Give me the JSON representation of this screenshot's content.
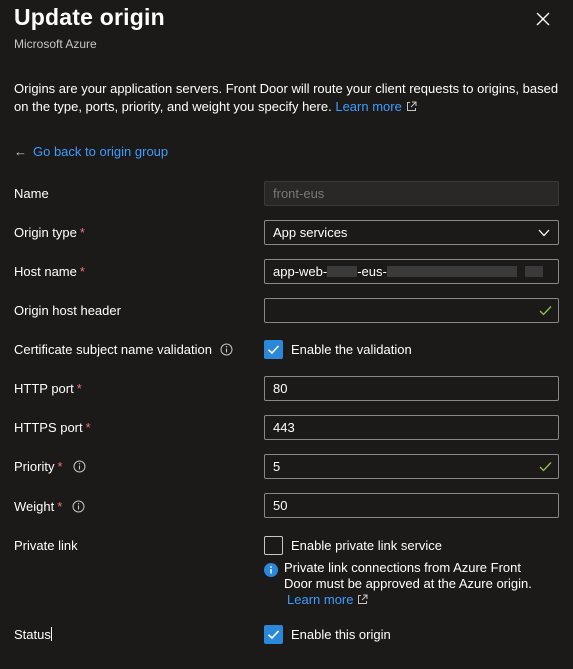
{
  "header": {
    "title": "Update origin",
    "subtitle": "Microsoft Azure"
  },
  "intro": {
    "text": "Origins are your application servers. Front Door will route your client requests to origins, based on the type, ports, priority, and weight you specify here.",
    "learn_more": "Learn more"
  },
  "back_link": "Go back to origin group",
  "form": {
    "name": {
      "label": "Name",
      "value": "front-eus"
    },
    "origin_type": {
      "label": "Origin type",
      "value": "App services"
    },
    "host_name": {
      "label": "Host name",
      "value_part1": "app-web-",
      "value_part2": "-eus-"
    },
    "origin_host_header": {
      "label": "Origin host header",
      "value": ""
    },
    "cert_validation": {
      "label": "Certificate subject name validation",
      "checkbox_label": "Enable the validation",
      "checked": true
    },
    "http_port": {
      "label": "HTTP port",
      "value": "80"
    },
    "https_port": {
      "label": "HTTPS port",
      "value": "443"
    },
    "priority": {
      "label": "Priority",
      "value": "5"
    },
    "weight": {
      "label": "Weight",
      "value": "50"
    },
    "private_link": {
      "label": "Private link",
      "checkbox_label": "Enable private link service",
      "checked": false,
      "note": "Private link connections from Azure Front Door must be approved at the Azure origin.",
      "learn_more": "Learn more"
    },
    "status": {
      "label": "Status",
      "checkbox_label": "Enable this origin",
      "checked": true
    }
  },
  "required_mark": "*",
  "colors": {
    "background": "#1b1a19",
    "accent": "#2b88d8",
    "link": "#3e9cff",
    "required": "#f1707b",
    "valid": "#92c353"
  }
}
